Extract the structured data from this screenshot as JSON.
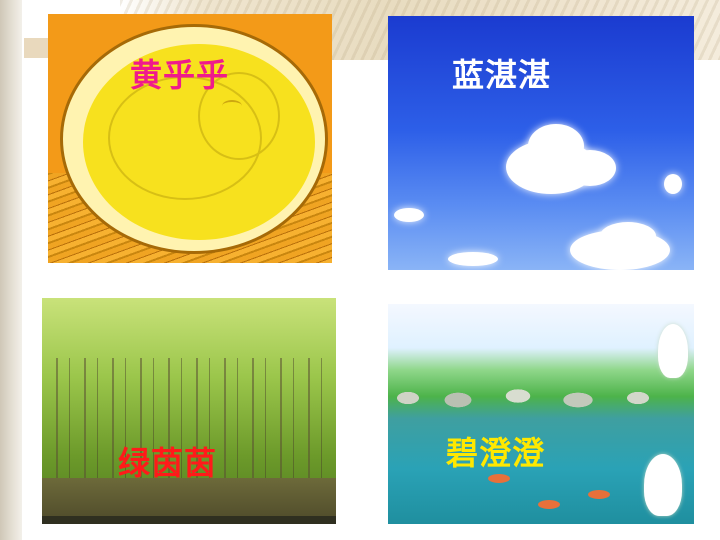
{
  "slide": {
    "panels": [
      {
        "id": "yellow",
        "label": "黄乎乎",
        "label_color": "#f01a8c"
      },
      {
        "id": "blue",
        "label": "蓝湛湛",
        "label_color": "#ffffff"
      },
      {
        "id": "green",
        "label": "绿茵茵",
        "label_color": "#ff1a1a"
      },
      {
        "id": "pond",
        "label": "碧澄澄",
        "label_color": "#ffe800"
      }
    ]
  },
  "icons": [
    "chick-in-egg-illustration",
    "blue-sky-clouds-photo",
    "green-forest-photo",
    "pond-with-lilies-photo"
  ]
}
